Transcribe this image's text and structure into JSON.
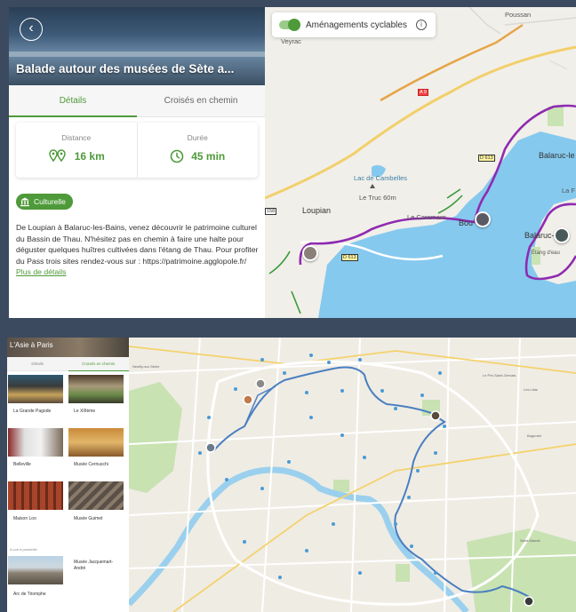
{
  "top": {
    "title": "Balade autour des musées de Sète a...",
    "tabs": [
      "Détails",
      "Croisés en chemin"
    ],
    "stats": {
      "distance_label": "Distance",
      "distance_value": "16 km",
      "duration_label": "Durée",
      "duration_value": "45 min"
    },
    "tag": "Culturelle",
    "description": "De Loupian à Balaruc-les-Bains, venez découvrir le patrimoine culturel du Bassin de Thau. N'hésitez pas en chemin à faire une halte pour déguster quelques huîtres cultivées dans l'étang de Thau. Pour profiter du Pass trois sites rendez-vous sur : https://patrimoine.agglopole.fr/",
    "more_link": "Plus de détails",
    "map": {
      "toggle_label": "Aménagements cyclables",
      "info_glyph": "i",
      "labels": {
        "poussan": "Poussan",
        "veyrac": "Veyrac",
        "loupian": "Loupian",
        "lac": "Lac de Cambelles",
        "truc": "Le Truc 60m",
        "caramare": "Le Caramare",
        "bouzigues": "Bou",
        "balaruc_le": "Balaruc-le",
        "balaruc": "Balaruc-l",
        "la_f": "La F",
        "etang": "Étang d'eau",
        "a9": "A 9",
        "d613a": "D 613",
        "d613b": "D 613",
        "r158": "158"
      }
    }
  },
  "bottom": {
    "title": "L'Asie à Paris",
    "tabs": [
      "Détails",
      "Croisés en chemin"
    ],
    "items": [
      {
        "name": "La Grande Pagode"
      },
      {
        "name": "Le XIIIème"
      },
      {
        "name": "Belleville"
      },
      {
        "name": "Musée Cernuschi"
      },
      {
        "name": "Maison Loo"
      },
      {
        "name": "Musée Guimet"
      },
      {
        "name": "Arc de Triomphe"
      },
      {
        "name": "Musée Jacquemart-André"
      }
    ],
    "section_label": "A voir à proximité",
    "map_labels": {
      "neuilly": "Neuilly-sur-Seine",
      "pre_st_gervais": "Le Pré-Saint-Gervais",
      "lilas": "Les Lilas",
      "bagnolet": "Bagnolet",
      "saint_mande": "Saint-Mandé"
    }
  },
  "colors": {
    "accent": "#4e9a3a",
    "route_top": "#8e2bb0",
    "route_bottom": "#4a7fc1",
    "water": "#86c9ee"
  },
  "icons": {
    "back": "chevron-left-icon",
    "distance": "route-pins-icon",
    "duration": "clock-icon",
    "tag": "museum-icon",
    "info": "info-icon"
  }
}
